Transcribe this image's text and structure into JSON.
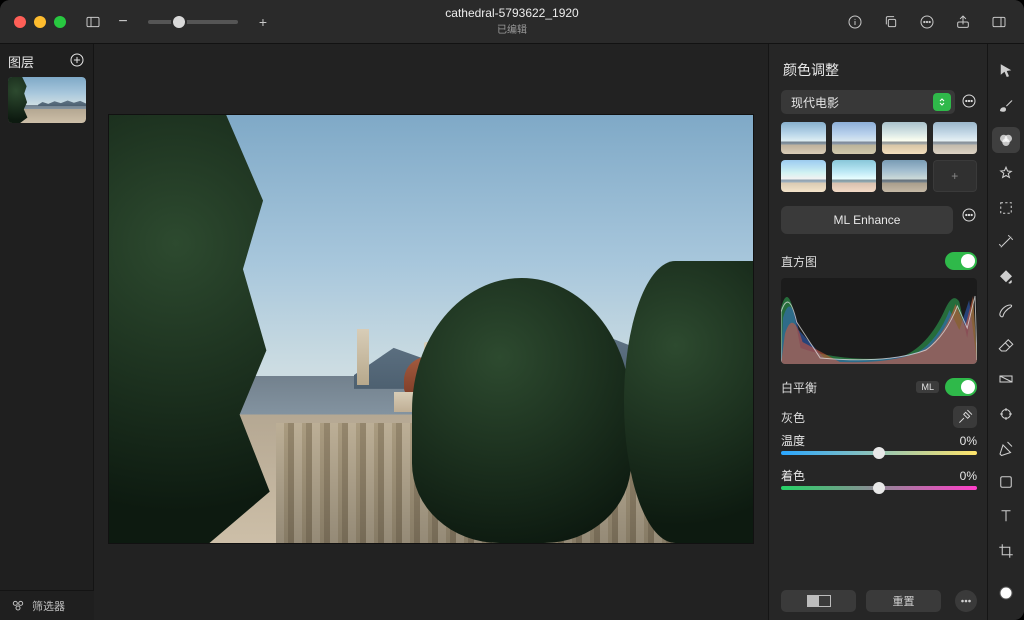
{
  "title": {
    "filename": "cathedral-5793622_1920",
    "status": "已编辑"
  },
  "layers": {
    "heading": "图层"
  },
  "panel": {
    "heading": "颜色调整",
    "preset_selected": "现代电影",
    "ml_enhance": "ML Enhance",
    "histogram": "直方图",
    "white_balance": "白平衡",
    "gray": "灰色",
    "temperature_label": "温度",
    "temperature_value": "0%",
    "tint_label": "着色",
    "tint_value": "0%",
    "ml_chip": "ML",
    "reset": "重置"
  },
  "filter": {
    "label": "筛选器"
  }
}
